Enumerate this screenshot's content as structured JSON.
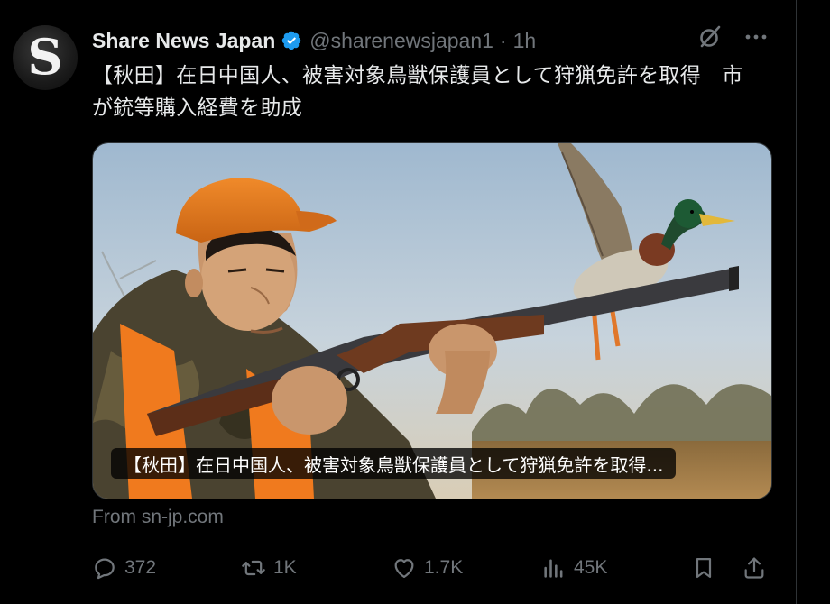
{
  "post": {
    "avatar_letter": "S",
    "author_name": "Share News Japan",
    "handle": "@sharenewsjapan1",
    "separator": "·",
    "time": "1h",
    "text": "【秋田】在日中国人、被害対象鳥獣保護員として狩猟免許を取得　市が銃等購入経費を助成",
    "card_title": "【秋田】在日中国人、被害対象鳥獣保護員として狩猟免許を取得...",
    "from": "From sn-jp.com"
  },
  "actions": {
    "replies": "372",
    "reposts": "1K",
    "likes": "1.7K",
    "views": "45K"
  },
  "icons": [
    "verified-icon",
    "grok-icon",
    "more-icon",
    "reply-icon",
    "repost-icon",
    "like-icon",
    "views-icon",
    "bookmark-icon",
    "share-icon"
  ],
  "colors": {
    "background": "#000000",
    "text": "#e7e9ea",
    "muted": "#71767b",
    "verified": "#1d9bf0"
  }
}
